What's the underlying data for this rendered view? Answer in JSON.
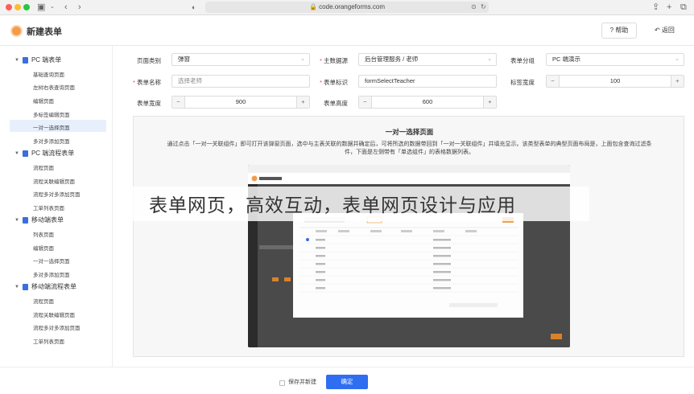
{
  "browser": {
    "url": "code.orangeforms.com"
  },
  "header": {
    "title": "新建表单",
    "help_label": "帮助",
    "back_label": "返回"
  },
  "sidebar": {
    "groups": [
      {
        "label": "PC 端表单",
        "items": [
          "基础查询页面",
          "左树右表查询页面",
          "编辑页面",
          "多标签编辑页面",
          "一对一选择页面",
          "多对多添加页面"
        ]
      },
      {
        "label": "PC 端流程表单",
        "items": [
          "流程页面",
          "流程关联编辑页面",
          "流程多对多添加页面",
          "工单列表页面"
        ]
      },
      {
        "label": "移动端表单",
        "items": [
          "列表页面",
          "编辑页面",
          "一对一选择页面",
          "多对多添加页面"
        ]
      },
      {
        "label": "移动端流程表单",
        "items": [
          "流程页面",
          "流程关联编辑页面",
          "流程多对多添加页面",
          "工单列表页面"
        ]
      }
    ],
    "selected": "一对一选择页面"
  },
  "form": {
    "page_type_label": "页面类别",
    "page_type_value": "弹窗",
    "datasource_label": "主数据源",
    "datasource_value": "后台管理服务 / 老师",
    "group_label": "表单分组",
    "group_value": "PC 端演示",
    "name_label": "表单名称",
    "name_placeholder": "选择老师",
    "id_label": "表单标识",
    "id_value": "formSelectTeacher",
    "label_width_label": "标签宽度",
    "label_width_value": "100",
    "width_label": "表单宽度",
    "width_value": "900",
    "height_label": "表单高度",
    "height_value": "600"
  },
  "preview": {
    "title": "一对一选择页面",
    "desc": "通过点击「一对一关联组件」即可打开该弹窗页面，选中与主表关联的数据并确定后，可将所选的数据带回到「一对一关联组件」并填充显示。该类型表单的典型页面布局是，上面包含查询过滤条件，下面是左侧带有「单选组件」的表格数据列表。"
  },
  "overlay_text": "表单网页，高效互动，表单网页设计与应用",
  "footer": {
    "save_new_label": "保存并新建",
    "ok_label": "确定"
  },
  "colors": {
    "accent": "#2f6ef0",
    "brand": "#f39c4a"
  }
}
